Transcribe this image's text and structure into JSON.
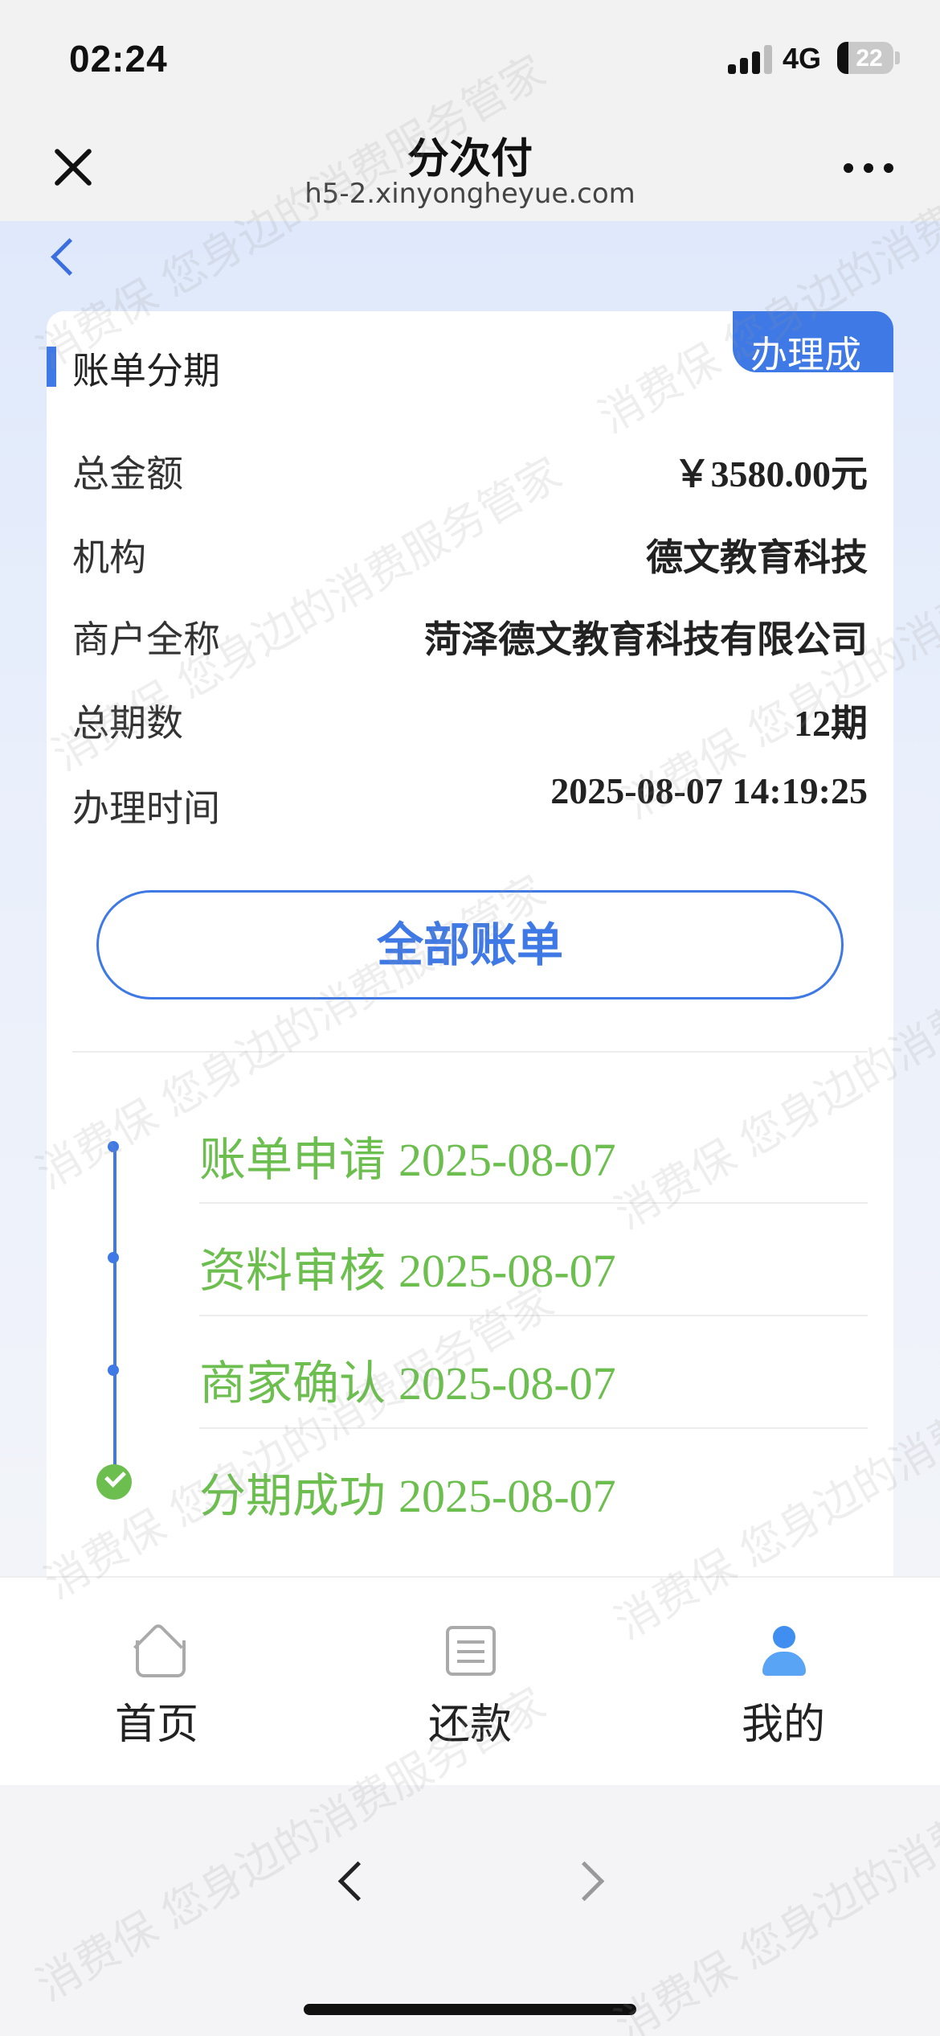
{
  "status_bar": {
    "time": "02:24",
    "network": "4G",
    "battery": "22"
  },
  "browser": {
    "title": "分次付",
    "url": "h5-2.xinyongheyue.com"
  },
  "card": {
    "status_tag": "办理成",
    "section_title": "账单分期",
    "rows": [
      {
        "label": "总金额",
        "value": "￥3580.00元"
      },
      {
        "label": "机构",
        "value": "德文教育科技"
      },
      {
        "label": "商户全称",
        "value": "菏泽德文教育科技有限公司"
      },
      {
        "label": "总期数",
        "value": "12期"
      },
      {
        "label": "办理时间",
        "value": "2025-08-07 14:19:25"
      }
    ],
    "all_bills_label": "全部账单"
  },
  "timeline": [
    {
      "step": "账单申请",
      "date": "2025-08-07"
    },
    {
      "step": "资料审核",
      "date": "2025-08-07"
    },
    {
      "step": "商家确认",
      "date": "2025-08-07"
    },
    {
      "step": "分期成功",
      "date": "2025-08-07"
    }
  ],
  "bottom_nav": [
    {
      "label": "首页",
      "icon": "home-icon"
    },
    {
      "label": "还款",
      "icon": "repay-icon"
    },
    {
      "label": "我的",
      "icon": "user-icon"
    }
  ],
  "watermark": "消费保 您身边的消费服务管家",
  "colors": {
    "accent": "#3f79e6",
    "success": "#6cbf4f"
  }
}
